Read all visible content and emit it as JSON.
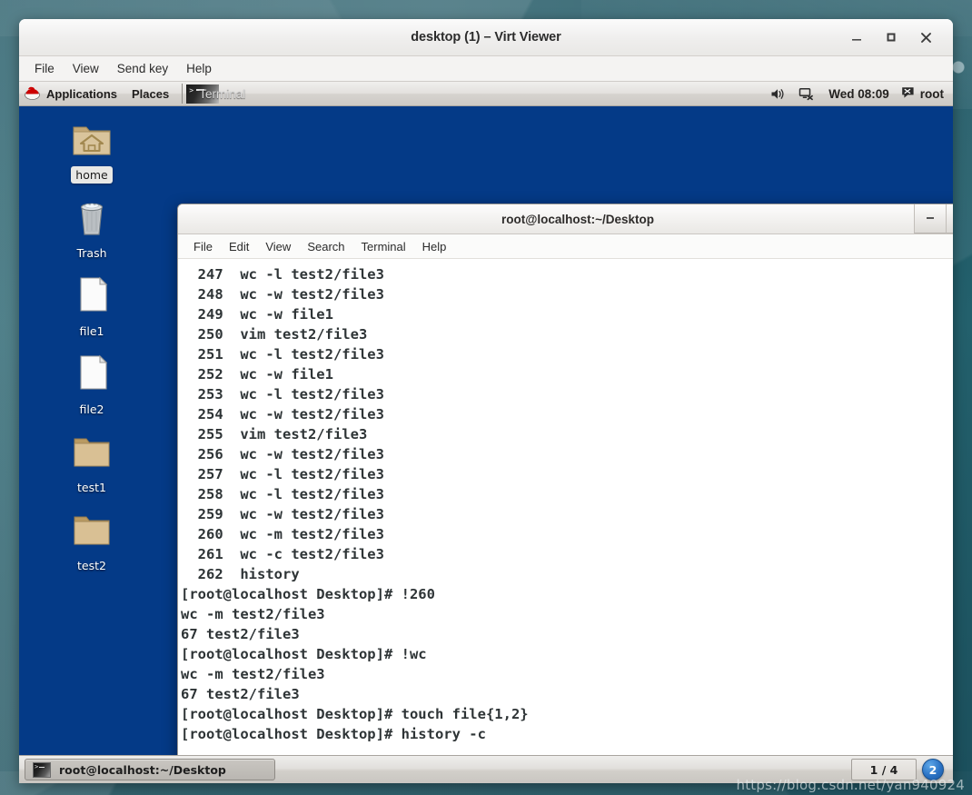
{
  "virt_window": {
    "title": "desktop (1) – Virt Viewer",
    "menus": [
      "File",
      "View",
      "Send key",
      "Help"
    ],
    "controls": {
      "minimize": "minimize-icon",
      "maximize": "maximize-icon",
      "close": "close-icon"
    }
  },
  "gnome_panel": {
    "applications_label": "Applications",
    "places_label": "Places",
    "window_list": [
      {
        "label": "Terminal",
        "icon": "terminal-icon"
      }
    ],
    "tray": {
      "volume_icon": "volume-icon",
      "network_icon": "network-disconnected-icon",
      "clock": "Wed 08:09",
      "user_icon": "user-chat-icon",
      "user": "root"
    }
  },
  "desktop": {
    "background_color": "#043a87",
    "icons": [
      {
        "label": "home",
        "type": "folder-home",
        "selected": true
      },
      {
        "label": "Trash",
        "type": "trash",
        "selected": false
      },
      {
        "label": "file1",
        "type": "document",
        "selected": false
      },
      {
        "label": "file2",
        "type": "document",
        "selected": false
      },
      {
        "label": "test1",
        "type": "folder",
        "selected": false
      },
      {
        "label": "test2",
        "type": "folder",
        "selected": false
      }
    ]
  },
  "terminal": {
    "title": "root@localhost:~/Desktop",
    "menus": [
      "File",
      "Edit",
      "View",
      "Search",
      "Terminal",
      "Help"
    ],
    "controls": {
      "minimize": "minimize-icon",
      "maximize": "maximize-icon"
    },
    "lines": [
      "  247  wc -l test2/file3",
      "  248  wc -w test2/file3",
      "  249  wc -w file1",
      "  250  vim test2/file3",
      "  251  wc -l test2/file3",
      "  252  wc -w file1",
      "  253  wc -l test2/file3",
      "  254  wc -w test2/file3",
      "  255  vim test2/file3",
      "  256  wc -w test2/file3",
      "  257  wc -l test2/file3",
      "  258  wc -l test2/file3",
      "  259  wc -w test2/file3",
      "  260  wc -m test2/file3",
      "  261  wc -c test2/file3",
      "  262  history",
      "[root@localhost Desktop]# !260",
      "wc -m test2/file3",
      "67 test2/file3",
      "[root@localhost Desktop]# !wc",
      "wc -m test2/file3",
      "67 test2/file3",
      "[root@localhost Desktop]# touch file{1,2}",
      "[root@localhost Desktop]# history -c"
    ]
  },
  "taskbar": {
    "window_button": {
      "label": "root@localhost:~/Desktop",
      "icon": "terminal-icon"
    },
    "workspace_switcher": "1 / 4",
    "notification_badge": "2"
  },
  "watermark": "https://blog.csdn.net/yan940924"
}
